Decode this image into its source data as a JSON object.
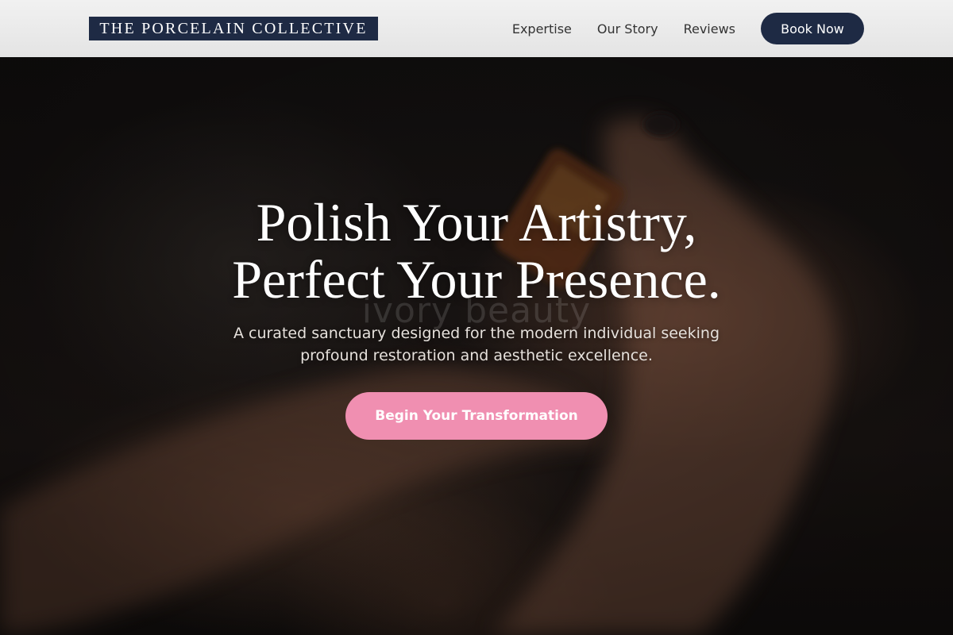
{
  "header": {
    "logo_text": "THE PORCELAIN COLLECTIVE",
    "nav": [
      {
        "label": "Expertise"
      },
      {
        "label": "Our Story"
      },
      {
        "label": "Reviews"
      }
    ],
    "book_label": "Book Now"
  },
  "hero": {
    "title_line1": "Polish Your Artistry,",
    "title_line2": "Perfect Your Presence.",
    "subtitle": "A curated sanctuary designed for the modern individual seeking profound restoration and aesthetic excellence.",
    "cta_label": "Begin Your Transformation",
    "watermark_text": "ivory beauty"
  },
  "colors": {
    "brand_navy": "#1e2a44",
    "cta_pink": "#f08fb1",
    "header_bg": "#ececec"
  }
}
